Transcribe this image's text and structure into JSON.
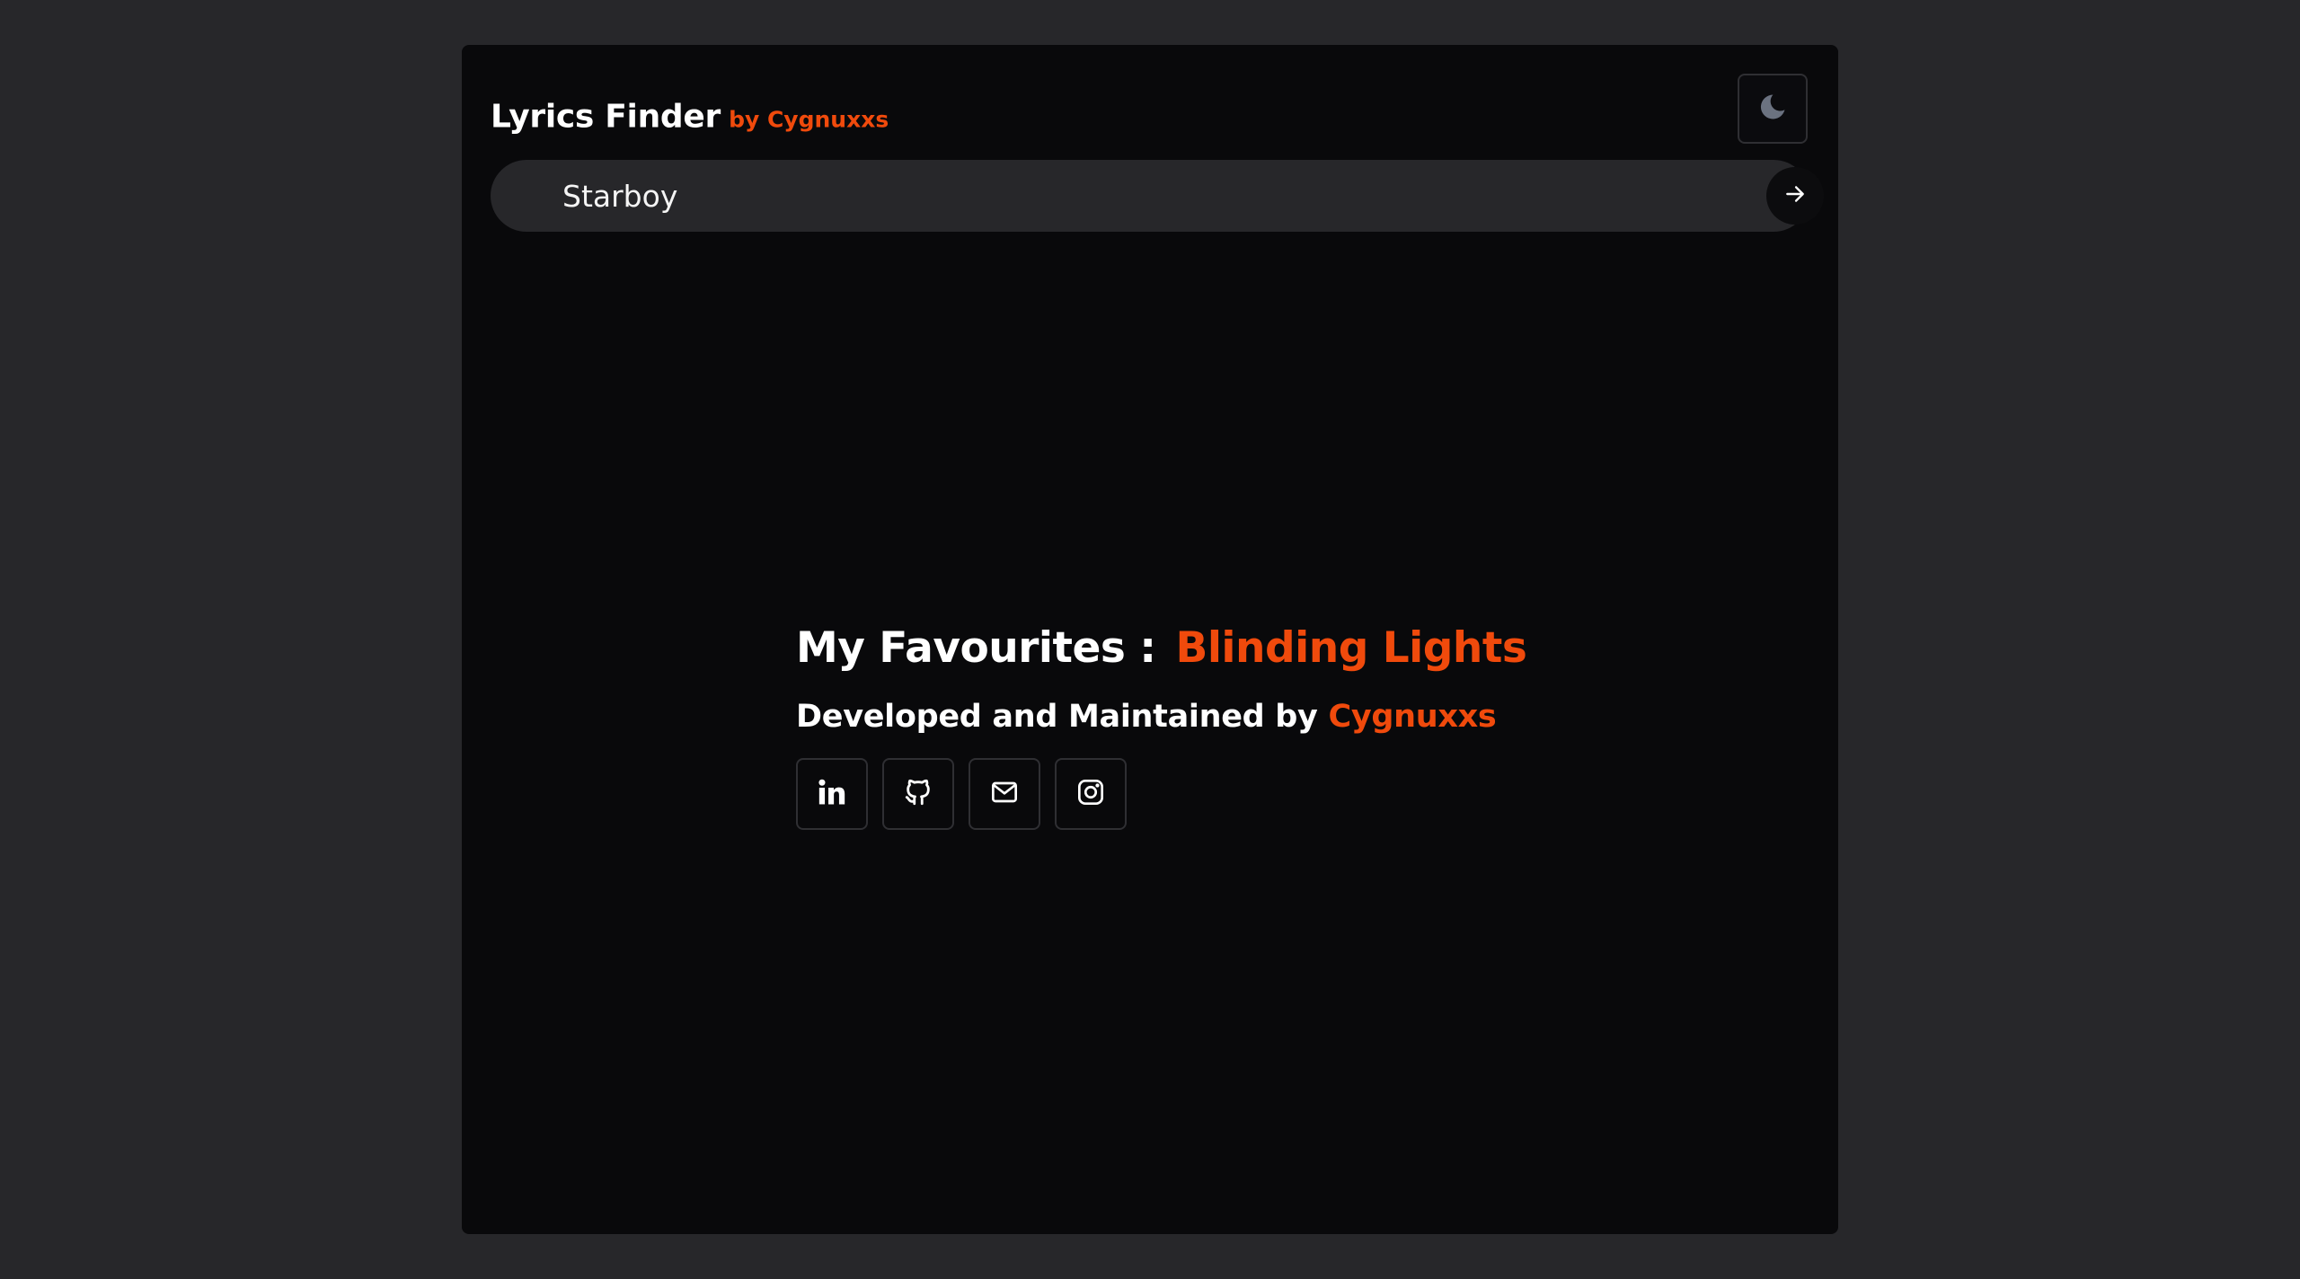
{
  "header": {
    "title": "Lyrics Finder",
    "byline": "by Cygnuxxs",
    "theme_toggle_icon": "moon-icon"
  },
  "search": {
    "value": "Starboy",
    "submit_icon": "arrow-right-icon"
  },
  "favourites": {
    "label": "My Favourites :",
    "song": "Blinding Lights"
  },
  "credits": {
    "prefix": "Developed and Maintained by",
    "name": "Cygnuxxs"
  },
  "socials": [
    {
      "icon": "linkedin-icon"
    },
    {
      "icon": "github-icon"
    },
    {
      "icon": "mail-icon"
    },
    {
      "icon": "instagram-icon"
    }
  ],
  "colors": {
    "accent": "#f04a0c",
    "page_background": "#27272a",
    "panel_background": "#09090b"
  }
}
